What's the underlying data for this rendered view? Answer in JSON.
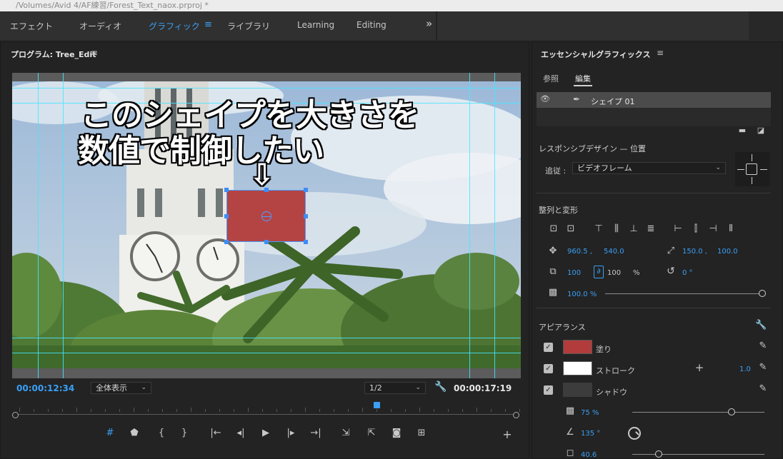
{
  "window": {
    "title": "/Volumes/Avid 4/AF練習/Forest_Text_naox.prproj *"
  },
  "workspaces": {
    "items": [
      "エフェクト",
      "オーディオ",
      "グラフィック",
      "ライブラリ",
      "Learning",
      "Editing"
    ],
    "active": "グラフィック",
    "menu_icon": "hamburger-icon",
    "more_icon": "double-chevron-right-icon"
  },
  "program": {
    "title": "プログラム: Tree_Edit",
    "overlay_line1": "このシェイプを大きさを",
    "overlay_line2": "数値で制御したい",
    "arrow": "⇩",
    "current_timecode": "00:00:12:34",
    "fit": "全体表示",
    "resolution": "1/2",
    "duration_timecode": "00:00:17:19",
    "shape_color": "#b44444",
    "playhead_fraction": 0.72,
    "transport_icons": [
      "#",
      "⬟",
      "{",
      "}",
      "|←",
      "◂|",
      "▶",
      "|▸",
      "→|",
      "⇲",
      "⇱",
      "📷",
      "⊞"
    ],
    "add_icon": "+"
  },
  "essential": {
    "title": "エッセンシャルグラフィックス",
    "tabs": [
      "参照",
      "編集"
    ],
    "active_tab": "編集",
    "layer": {
      "name": "シェイプ 01"
    },
    "responsive": {
      "title": "レスポンシブデザイン — 位置",
      "follow_label": "追従 :",
      "follow_value": "ビデオフレーム"
    },
    "align": {
      "title": "整列と変形",
      "position_x": "960.5 ,",
      "position_y": "540.0",
      "anchor_x": "150.0 ,",
      "anchor_y": "100.0",
      "scale_w": "100",
      "scale_h": "100",
      "scale_unit": "%",
      "rotation": "0 °",
      "opacity": "100.0 %",
      "opacity_fraction": 1.0
    },
    "appearance": {
      "title": "アピアランス",
      "fill_label": "塗り",
      "fill_color": "#b23c3c",
      "stroke_label": "ストローク",
      "stroke_color": "#ffffff",
      "stroke_width": "1.0",
      "shadow_label": "シャドウ",
      "shadow_opacity": "75 %",
      "shadow_opacity_fraction": 0.75,
      "shadow_angle": "135 °",
      "shadow_distance": "40.6",
      "shadow_distance_fraction": 0.2
    }
  }
}
